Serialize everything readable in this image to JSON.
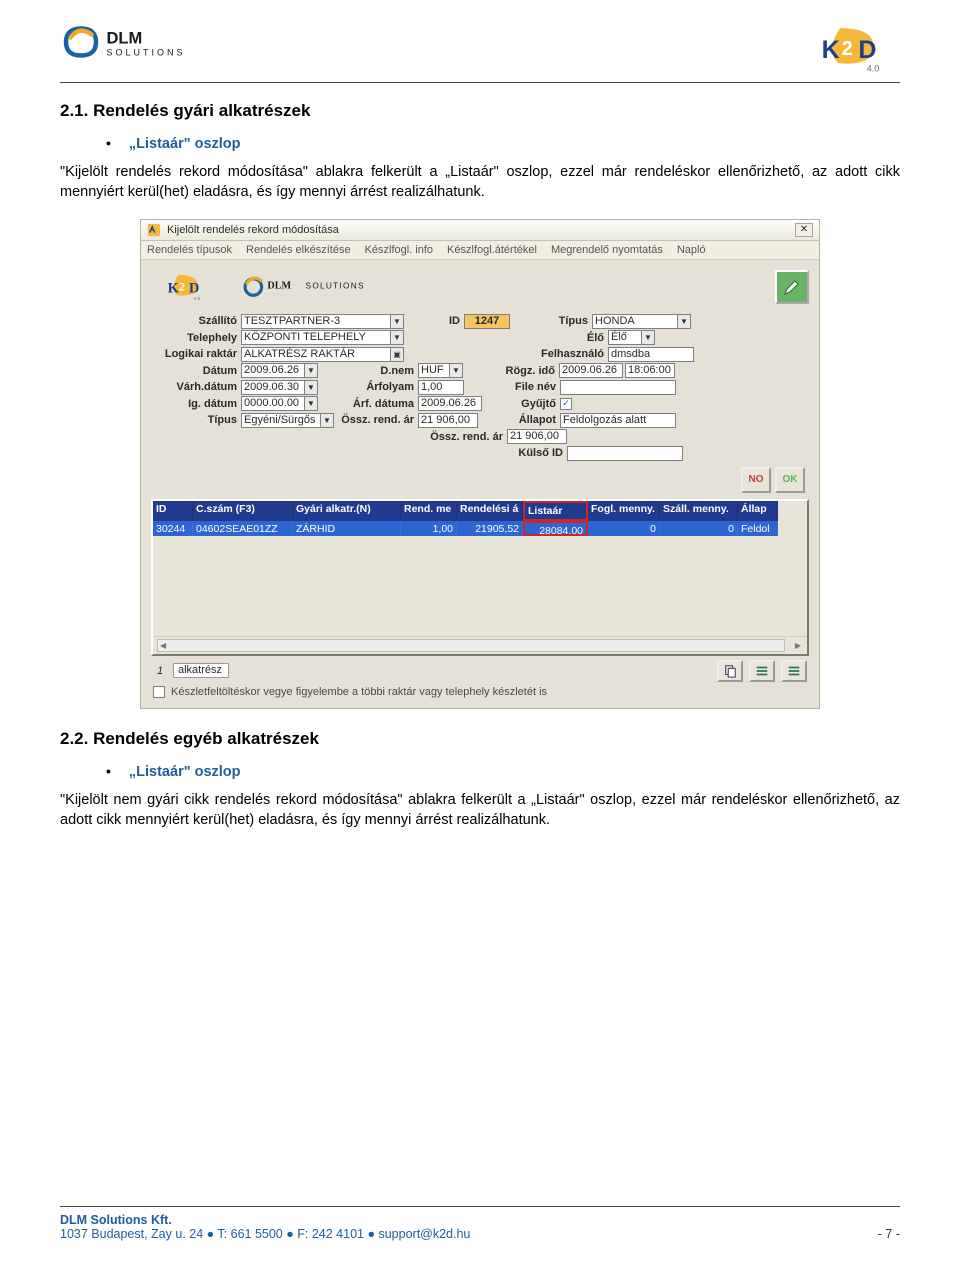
{
  "header": {
    "logo_dlm": "DLM SOLUTIONS",
    "logo_k2d": "K2D 4.0"
  },
  "section21": {
    "heading": "2.1.    Rendelés gyári alkatrészek",
    "bullet": "„Listaár\" oszlop",
    "paragraph": "\"Kijelölt rendelés rekord módosítása\" ablakra felkerült a „Listaár\" oszlop, ezzel már rendeléskor ellenőrizhető, az adott cikk mennyiért kerül(het) eladásra, és így mennyi árrést realizálhatunk."
  },
  "screenshot": {
    "window_title": "Kijelölt rendelés rekord módosítása",
    "menu": [
      "Rendelés típusok",
      "Rendelés elkészítése",
      "Készlfogl. info",
      "Készlfogl.átértékel",
      "Megrendelő nyomtatás",
      "Napló"
    ],
    "form": {
      "szallito_label": "Szállító",
      "szallito": "TESZTPARTNER-3",
      "id_label": "ID",
      "id": "1247",
      "tipus_label": "Típus",
      "tipus": "HONDA",
      "telephely_label": "Telephely",
      "telephely": "KÖZPONTI TELEPHELY",
      "elo_label": "Élő",
      "elo": "Élő",
      "raktar_label": "Logikai raktár",
      "raktar": "ALKATRÉSZ RAKTÁR",
      "felh_label": "Felhasználó",
      "felh": "dmsdba",
      "datum_label": "Dátum",
      "datum": "2009.06.26",
      "dnem_label": "D.nem",
      "dnem": "HUF",
      "rogz_label": "Rögz. idő",
      "rogz": "2009.06.26",
      "rogz_t": "18:06:00",
      "varh_label": "Várh.dátum",
      "varh": "2009.06.30",
      "arfolyam_label": "Árfolyam",
      "arfolyam": "1,00",
      "filenev_label": "File név",
      "filenev": "",
      "igdatum_label": "Ig. dátum",
      "igdatum": "0000.00.00",
      "arfdat_label": "Árf. dátuma",
      "arfdat": "2009.06.26",
      "gyujto_label": "Gyűjtő",
      "tipus2_label": "Típus",
      "tipus2": "Egyéni/Sürgős",
      "osszrend_label": "Össz. rend. ár",
      "osszrend": "21 906,00",
      "allapot_label": "Állapot",
      "allapot": "Feldolgozás alatt",
      "osszrend2_label": "Össz. rend. ár",
      "osszrend2": "21 906,00",
      "kulsoid_label": "Külső ID",
      "kulsoid": ""
    },
    "grid": {
      "col1": "ID",
      "col2": "C.szám (F3)",
      "col3": "Gyári alkatr.(N)",
      "col4": "Rend. me",
      "col5": "Rendelési á",
      "col6": "Listaár",
      "col7": "Fogl. menny.",
      "col8": "Száll. menny.",
      "col9": "Állap",
      "r1_1": "30244",
      "r1_2": "04602SEAE01ZZ",
      "r1_3": "ZÁRHID",
      "r1_4": "1,00",
      "r1_5": "21905,52",
      "r1_6": "28084,00",
      "r1_7": "0",
      "r1_8": "0",
      "r1_9": "Feldol"
    },
    "footer_count": "1",
    "footer_cat": "alkatrész",
    "footer_chk_label": "Készletfeltöltéskor vegye figyelembe a többi raktár vagy telephely készletét is",
    "btn_no": "NO",
    "btn_ok": "OK"
  },
  "section22": {
    "heading": "2.2.    Rendelés egyéb alkatrészek",
    "bullet": "„Listaár\" oszlop",
    "paragraph": "\"Kijelölt nem gyári cikk rendelés rekord módosítása\" ablakra felkerült a „Listaár\" oszlop, ezzel már rendeléskor ellenőrizhető, az adott cikk mennyiért kerül(het) eladásra, és így mennyi árrést realizálhatunk."
  },
  "footer": {
    "company": "DLM Solutions Kft.",
    "address": "1037 Budapest, Zay u. 24  ●  T: 661 5500  ●  F: 242 4101  ●  support@k2d.hu",
    "page": "- 7 -"
  }
}
